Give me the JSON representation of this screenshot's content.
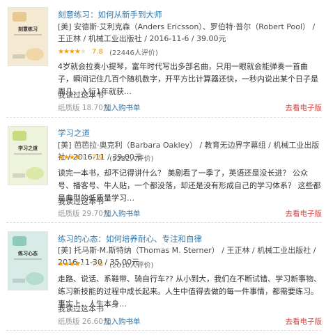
{
  "books": [
    {
      "title": "刻意练习：如何从新手到大师",
      "meta": "[美] 安德斯·艾利克森（Anders Ericsson）、罗伯特·普尔（Robert Pool） / 王正林 / 机械工业出版社 / 2016-11-6 / 39.00元",
      "rating_score": "7.8",
      "rating_count": "(22446人评价)",
      "stars_full": 4,
      "description": "4岁就会拉奏小提琴，富年时代写出多部名曲，只用一眼就会能弹奏一首曲子，瞬间记住几百个随机数字，开平方比计算器还快，一秒内说出某个日子是周几，入行1年就获…",
      "read_label": "我读过这本书",
      "price_label": "纸质版 18.70元",
      "cart_label": "加入购书单",
      "ebook_label": "去看电子版",
      "cover_colors": {
        "bg": "#f4ead2",
        "deco1": "#e8c991",
        "deco2": "#f0d6a8",
        "title": "刻意练习"
      }
    },
    {
      "title": "学习之道",
      "meta": "[美] 芭芭拉·奥克利（Barbara Oakley） / 教育无边界字幕组 / 机械工业出版社 / 2016-11 / 39.00元",
      "rating_score": "7.9",
      "rating_count": "(5282人评价)",
      "stars_full": 4,
      "description": "读完一本书，却不记得讲什么？ 美剧看了一季了，英语还是没长进？ 公众号、播客号、牛人贴，一个都没落，却还是没有形成自己的学习体系？ 这些都是典型的低质量学习…",
      "read_label": "我读过这本书",
      "price_label": "纸质版 29.70元",
      "cart_label": "加入购书单",
      "ebook_label": "去看电子版",
      "cover_colors": {
        "bg": "#eef3dc",
        "deco1": "#c8db7f",
        "deco2": "#dbe8a8",
        "title": "学习之道"
      }
    },
    {
      "title": "练习的心态：如何培养耐心、专注和自律",
      "meta": "[美] 托马斯·M.斯特纳（Thomas M. Sterner） / 王正林 / 机械工业出版社 / 2016-11-30 / 35.00元",
      "rating_score": "7.8",
      "rating_count": "(2010人评价)",
      "stars_full": 4,
      "description": "走路、说话、系鞋带、骑自行车?? 从小到大，我们在不断试错、学习新事物、练习新技能的过程中成长起来。人生中值得去做的每一件事情，都需要练习。事实上，人生本身…",
      "read_label": "我读过这本书",
      "price_label": "纸质版 26.60元",
      "cart_label": "加入购书单",
      "ebook_label": "去看电子版",
      "cover_colors": {
        "bg": "#d7ece6",
        "deco1": "#8fcbb9",
        "deco2": "#b5dccf",
        "title": "练习心态"
      }
    }
  ]
}
